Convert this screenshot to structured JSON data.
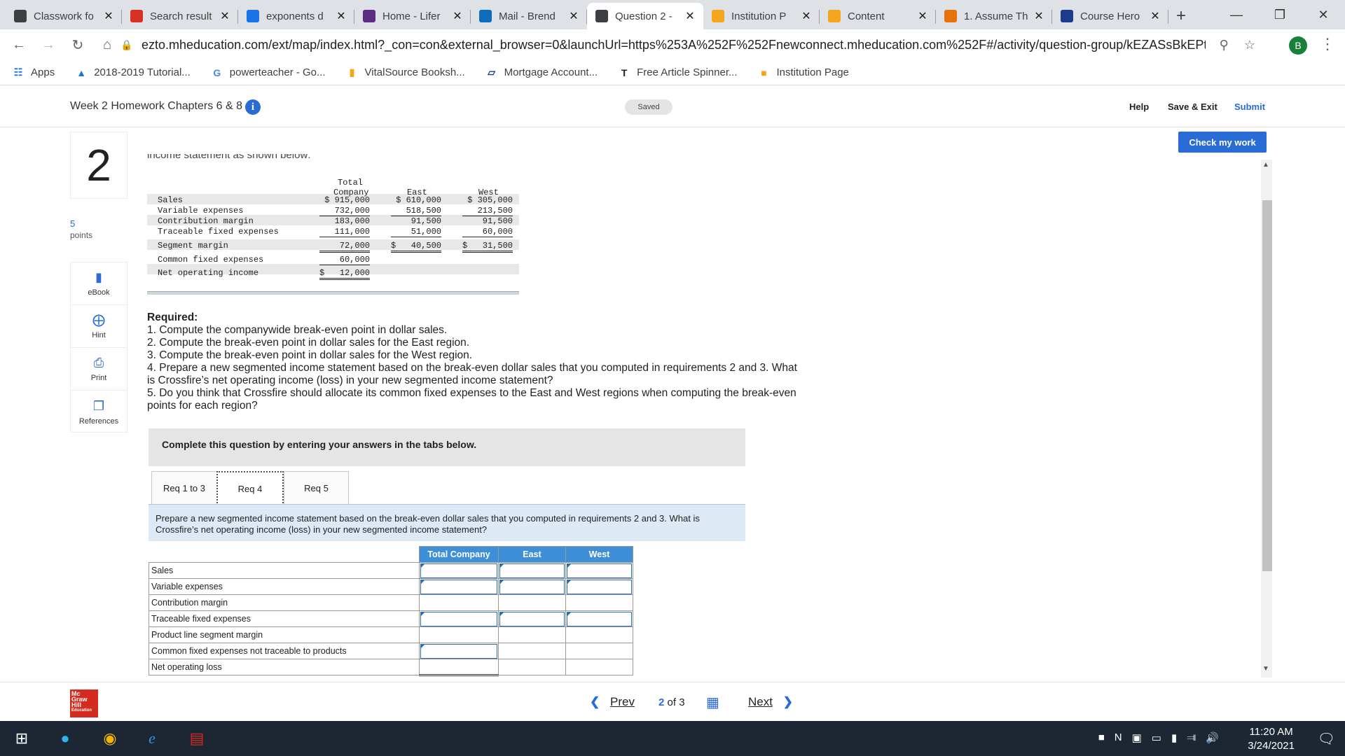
{
  "browser": {
    "tabs": [
      {
        "title": "Classwork fo",
        "icon": "classroom-icon",
        "color": "#3c4043"
      },
      {
        "title": "Search result",
        "icon": "gmail-icon",
        "color": "#d93025"
      },
      {
        "title": "exponents d",
        "icon": "drive-icon",
        "color": "#1a73e8"
      },
      {
        "title": "Home - Lifer",
        "icon": "lifer-icon",
        "color": "#5b2c83"
      },
      {
        "title": "Mail - Brend",
        "icon": "outlook-icon",
        "color": "#0f6cbd"
      },
      {
        "title": "Question 2 -",
        "icon": "mcgraw-icon",
        "color": "#3c4043"
      },
      {
        "title": "Institution P",
        "icon": "institution-icon",
        "color": "#f4a51c"
      },
      {
        "title": "Content",
        "icon": "content-icon",
        "color": "#f4a51c"
      },
      {
        "title": "1. Assume Th",
        "icon": "chegg-icon",
        "color": "#e8710a"
      },
      {
        "title": "Course Hero",
        "icon": "coursehero-icon",
        "color": "#1e3a8a"
      }
    ],
    "active_tab": 5,
    "new_tab": "+",
    "url": "ezto.mheducation.com/ext/map/index.html?_con=con&external_browser=0&launchUrl=https%253A%252F%252Fnewconnect.mheducation.com%252F#/activity/question-group/kEZASsBkEPtVFQ...",
    "profile_initial": "B"
  },
  "bookmarks": [
    {
      "label": "Apps",
      "icon": "apps-grid-icon"
    },
    {
      "label": "2018-2019 Tutorial...",
      "icon": "drive-icon"
    },
    {
      "label": "powerteacher - Go...",
      "icon": "google-icon"
    },
    {
      "label": "VitalSource Booksh...",
      "icon": "vitalsource-icon"
    },
    {
      "label": "Mortgage Account...",
      "icon": "mortgage-icon"
    },
    {
      "label": "Free Article Spinner...",
      "icon": "article-spinner-icon"
    },
    {
      "label": "Institution Page",
      "icon": "institution-icon"
    }
  ],
  "header": {
    "title": "Week 2 Homework Chapters 6 & 8",
    "saved": "Saved",
    "help": "Help",
    "save_exit": "Save & Exit",
    "submit": "Submit",
    "check_work": "Check my work"
  },
  "question": {
    "number": "2",
    "points_value": "5",
    "points_label": "points",
    "cut_text": "income statement as shown below:"
  },
  "tools": [
    {
      "label": "eBook",
      "icon": "ebook-icon"
    },
    {
      "label": "Hint",
      "icon": "hint-icon"
    },
    {
      "label": "Print",
      "icon": "print-icon"
    },
    {
      "label": "References",
      "icon": "references-icon"
    }
  ],
  "income_statement": {
    "headers": {
      "total_line1": "Total",
      "total_line2": "Company",
      "east": "East",
      "west": "West"
    },
    "rows": [
      {
        "label": "Sales",
        "total": "$ 915,000",
        "east": "$ 610,000",
        "west": "$ 305,000"
      },
      {
        "label": "Variable expenses",
        "total": "732,000",
        "east": "518,500",
        "west": "213,500"
      },
      {
        "label": "Contribution margin",
        "total": "183,000",
        "east": "91,500",
        "west": "91,500"
      },
      {
        "label": "Traceable fixed expenses",
        "total": "111,000",
        "east": "51,000",
        "west": "60,000"
      },
      {
        "label": "Segment margin",
        "total": "72,000",
        "east_dollar": "$",
        "east": "40,500",
        "west_dollar": "$",
        "west": "31,500"
      },
      {
        "label": "Common fixed expenses",
        "total": "60,000"
      },
      {
        "label": "Net operating income",
        "total_dollar": "$",
        "total": "12,000"
      }
    ]
  },
  "required": {
    "heading": "Required:",
    "items": [
      "1. Compute the companywide break-even point in dollar sales.",
      "2. Compute the break-even point in dollar sales for the East region.",
      "3. Compute the break-even point in dollar sales for the West region.",
      "4. Prepare a new segmented income statement based on the break-even dollar sales that you computed in requirements 2 and 3. What is Crossfire’s net operating income (loss) in your new segmented income statement?",
      "5. Do you think that Crossfire should allocate its common fixed expenses to the East and West regions when computing the break-even points for each region?"
    ]
  },
  "complete_box": "Complete this question by entering your answers in the tabs below.",
  "req_tabs": [
    "Req 1 to 3",
    "Req 4",
    "Req 5"
  ],
  "active_req_tab": 1,
  "tab_instructions": "Prepare a new segmented income statement based on the break-even dollar sales that you computed in requirements 2 and 3. What is Crossfire’s net operating income (loss) in your new segmented income statement?",
  "answer_table": {
    "headers": [
      "Total Company",
      "East",
      "West"
    ],
    "rows": [
      "Sales",
      "Variable expenses",
      "Contribution margin",
      "Traceable fixed expenses",
      "Product line segment margin",
      "Common fixed expenses not traceable to products",
      "Net operating loss"
    ]
  },
  "footer": {
    "logo": [
      "Mc",
      "Graw",
      "Hill",
      "Education"
    ],
    "prev": "Prev",
    "page_current": "2",
    "page_of": "of 3",
    "next": "Next"
  },
  "taskbar": {
    "time": "11:20 AM",
    "date": "3/24/2021"
  }
}
